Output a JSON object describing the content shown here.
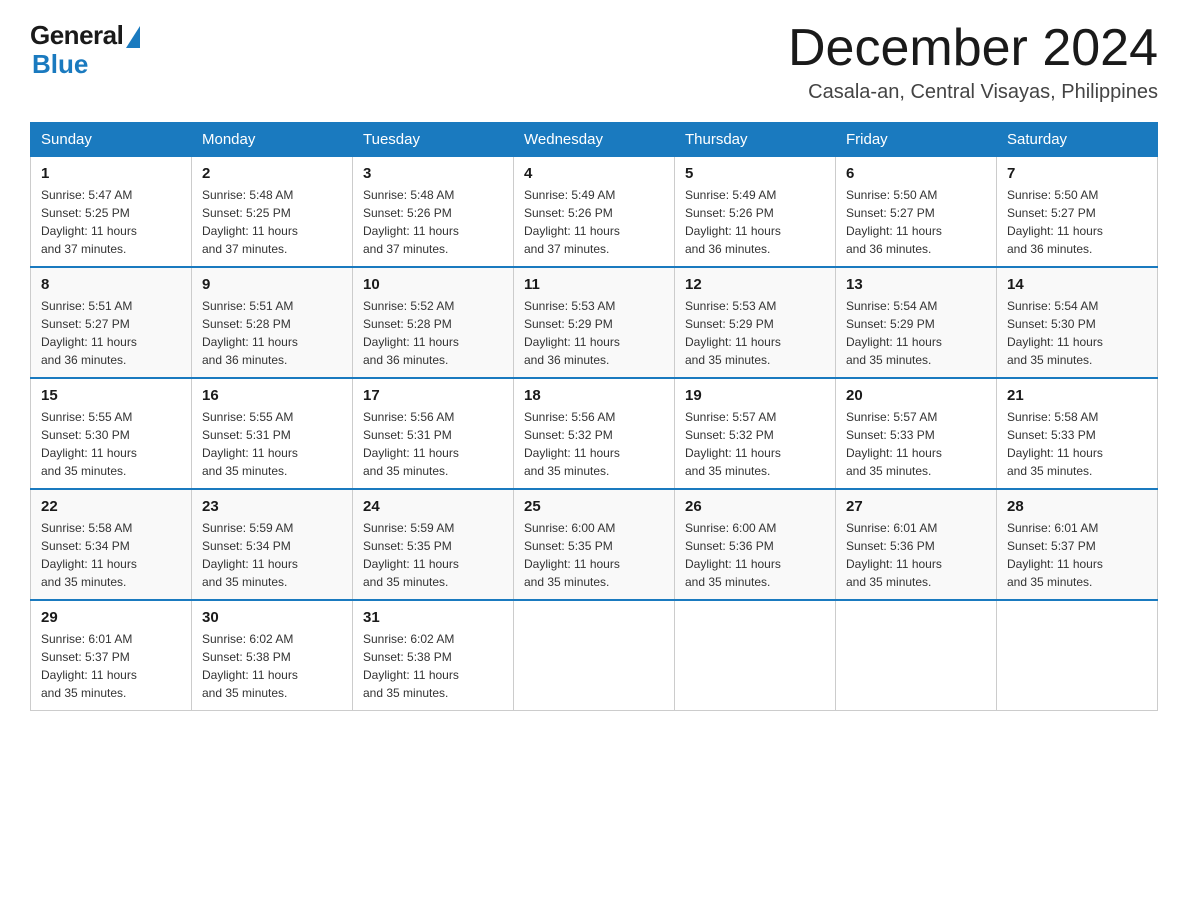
{
  "logo": {
    "general": "General",
    "blue": "Blue"
  },
  "title": "December 2024",
  "location": "Casala-an, Central Visayas, Philippines",
  "headers": [
    "Sunday",
    "Monday",
    "Tuesday",
    "Wednesday",
    "Thursday",
    "Friday",
    "Saturday"
  ],
  "weeks": [
    [
      {
        "day": "1",
        "sunrise": "5:47 AM",
        "sunset": "5:25 PM",
        "daylight": "11 hours and 37 minutes."
      },
      {
        "day": "2",
        "sunrise": "5:48 AM",
        "sunset": "5:25 PM",
        "daylight": "11 hours and 37 minutes."
      },
      {
        "day": "3",
        "sunrise": "5:48 AM",
        "sunset": "5:26 PM",
        "daylight": "11 hours and 37 minutes."
      },
      {
        "day": "4",
        "sunrise": "5:49 AM",
        "sunset": "5:26 PM",
        "daylight": "11 hours and 37 minutes."
      },
      {
        "day": "5",
        "sunrise": "5:49 AM",
        "sunset": "5:26 PM",
        "daylight": "11 hours and 36 minutes."
      },
      {
        "day": "6",
        "sunrise": "5:50 AM",
        "sunset": "5:27 PM",
        "daylight": "11 hours and 36 minutes."
      },
      {
        "day": "7",
        "sunrise": "5:50 AM",
        "sunset": "5:27 PM",
        "daylight": "11 hours and 36 minutes."
      }
    ],
    [
      {
        "day": "8",
        "sunrise": "5:51 AM",
        "sunset": "5:27 PM",
        "daylight": "11 hours and 36 minutes."
      },
      {
        "day": "9",
        "sunrise": "5:51 AM",
        "sunset": "5:28 PM",
        "daylight": "11 hours and 36 minutes."
      },
      {
        "day": "10",
        "sunrise": "5:52 AM",
        "sunset": "5:28 PM",
        "daylight": "11 hours and 36 minutes."
      },
      {
        "day": "11",
        "sunrise": "5:53 AM",
        "sunset": "5:29 PM",
        "daylight": "11 hours and 36 minutes."
      },
      {
        "day": "12",
        "sunrise": "5:53 AM",
        "sunset": "5:29 PM",
        "daylight": "11 hours and 35 minutes."
      },
      {
        "day": "13",
        "sunrise": "5:54 AM",
        "sunset": "5:29 PM",
        "daylight": "11 hours and 35 minutes."
      },
      {
        "day": "14",
        "sunrise": "5:54 AM",
        "sunset": "5:30 PM",
        "daylight": "11 hours and 35 minutes."
      }
    ],
    [
      {
        "day": "15",
        "sunrise": "5:55 AM",
        "sunset": "5:30 PM",
        "daylight": "11 hours and 35 minutes."
      },
      {
        "day": "16",
        "sunrise": "5:55 AM",
        "sunset": "5:31 PM",
        "daylight": "11 hours and 35 minutes."
      },
      {
        "day": "17",
        "sunrise": "5:56 AM",
        "sunset": "5:31 PM",
        "daylight": "11 hours and 35 minutes."
      },
      {
        "day": "18",
        "sunrise": "5:56 AM",
        "sunset": "5:32 PM",
        "daylight": "11 hours and 35 minutes."
      },
      {
        "day": "19",
        "sunrise": "5:57 AM",
        "sunset": "5:32 PM",
        "daylight": "11 hours and 35 minutes."
      },
      {
        "day": "20",
        "sunrise": "5:57 AM",
        "sunset": "5:33 PM",
        "daylight": "11 hours and 35 minutes."
      },
      {
        "day": "21",
        "sunrise": "5:58 AM",
        "sunset": "5:33 PM",
        "daylight": "11 hours and 35 minutes."
      }
    ],
    [
      {
        "day": "22",
        "sunrise": "5:58 AM",
        "sunset": "5:34 PM",
        "daylight": "11 hours and 35 minutes."
      },
      {
        "day": "23",
        "sunrise": "5:59 AM",
        "sunset": "5:34 PM",
        "daylight": "11 hours and 35 minutes."
      },
      {
        "day": "24",
        "sunrise": "5:59 AM",
        "sunset": "5:35 PM",
        "daylight": "11 hours and 35 minutes."
      },
      {
        "day": "25",
        "sunrise": "6:00 AM",
        "sunset": "5:35 PM",
        "daylight": "11 hours and 35 minutes."
      },
      {
        "day": "26",
        "sunrise": "6:00 AM",
        "sunset": "5:36 PM",
        "daylight": "11 hours and 35 minutes."
      },
      {
        "day": "27",
        "sunrise": "6:01 AM",
        "sunset": "5:36 PM",
        "daylight": "11 hours and 35 minutes."
      },
      {
        "day": "28",
        "sunrise": "6:01 AM",
        "sunset": "5:37 PM",
        "daylight": "11 hours and 35 minutes."
      }
    ],
    [
      {
        "day": "29",
        "sunrise": "6:01 AM",
        "sunset": "5:37 PM",
        "daylight": "11 hours and 35 minutes."
      },
      {
        "day": "30",
        "sunrise": "6:02 AM",
        "sunset": "5:38 PM",
        "daylight": "11 hours and 35 minutes."
      },
      {
        "day": "31",
        "sunrise": "6:02 AM",
        "sunset": "5:38 PM",
        "daylight": "11 hours and 35 minutes."
      },
      null,
      null,
      null,
      null
    ]
  ],
  "labels": {
    "sunrise": "Sunrise: ",
    "sunset": "Sunset: ",
    "daylight": "Daylight: "
  }
}
